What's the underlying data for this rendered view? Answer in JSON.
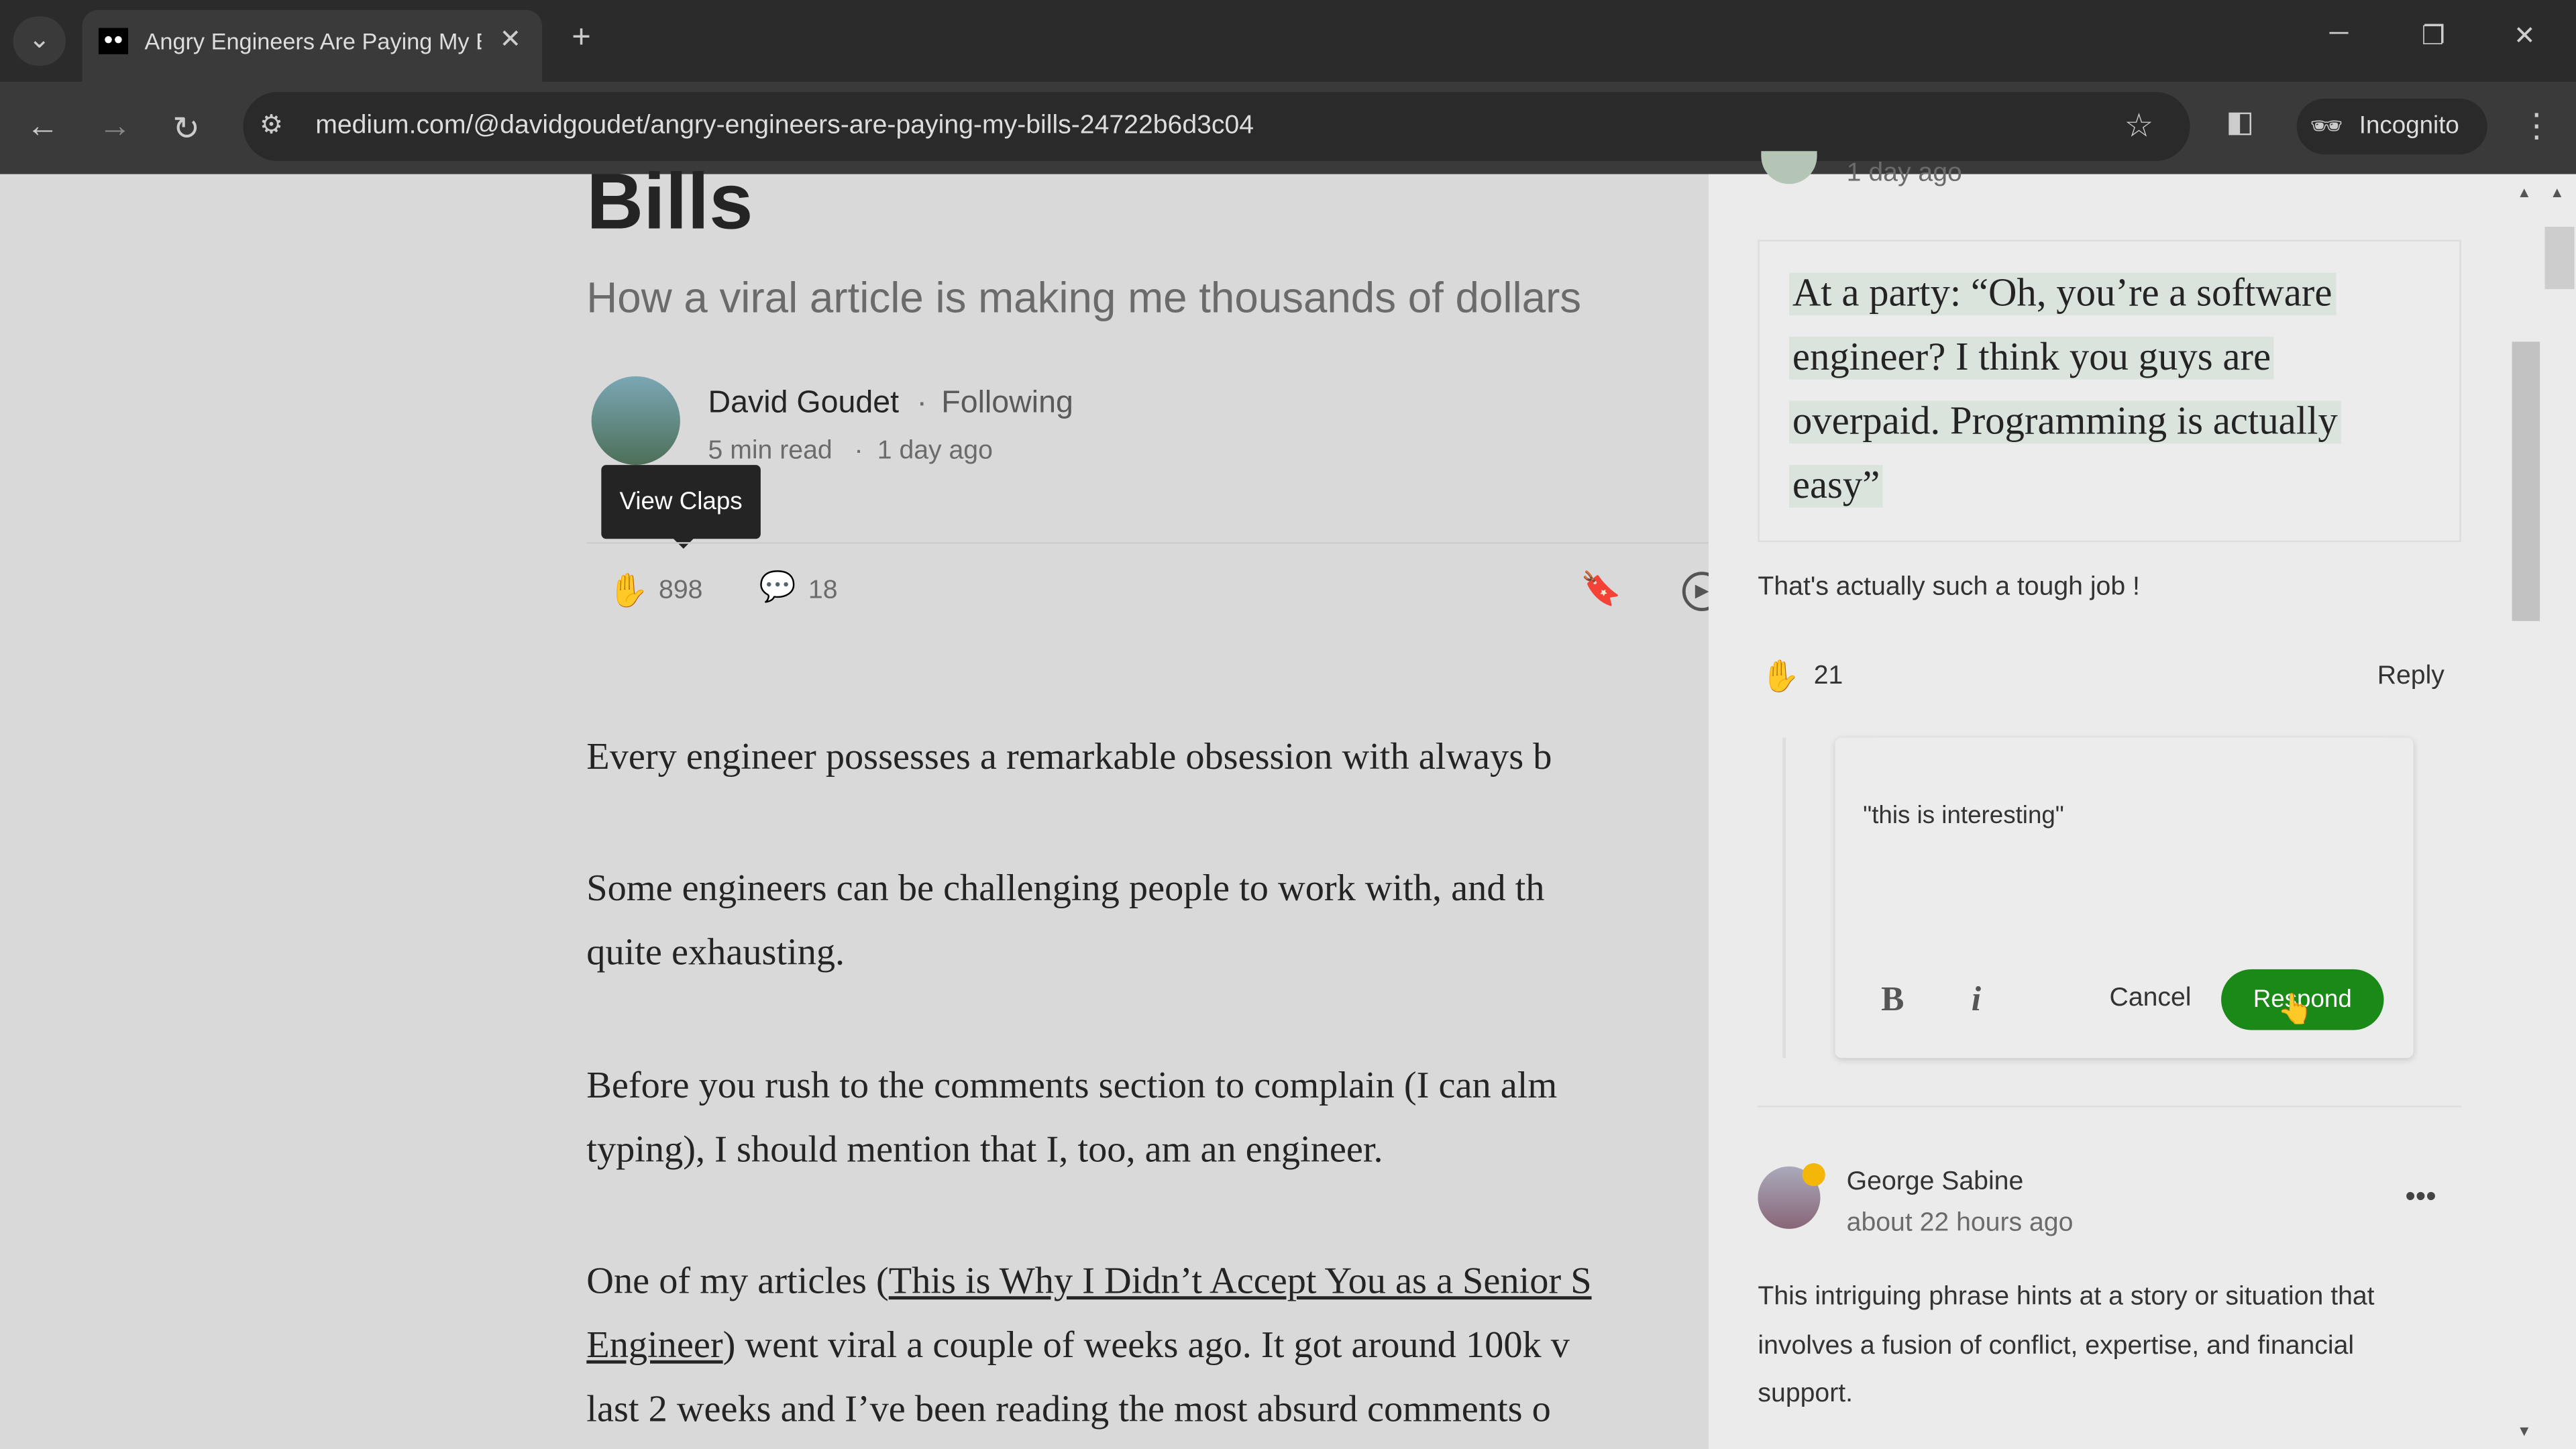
{
  "browser": {
    "tab_title": "Angry Engineers Are Paying My Bills",
    "url": "medium.com/@davidgoudet/angry-engineers-are-paying-my-bills-24722b6d3c04",
    "profile": "Incognito"
  },
  "article": {
    "title_fragment": "Bills",
    "subtitle": "How a viral article is making me thousands of dollars",
    "author": "David Goudet",
    "follow_status": "Following",
    "read_time": "5 min read",
    "published": "1 day ago",
    "tooltip": "View Claps",
    "claps": "898",
    "comments": "18",
    "paragraphs": [
      "Every engineer possesses a remarkable obsession with always b",
      "Some engineers can be challenging people to work with, and th",
      "quite exhausting.",
      "Before you rush to the comments section to complain (I can alm",
      "typing), I should mention that I, too, am an engineer."
    ],
    "para5": {
      "pre": "One of my articles (",
      "link1": "This is Why I Didn’t Accept You as a Senior S",
      "link2": "Engineer",
      "post2": ") went viral a couple of weeks ago. It got around 100k v",
      "line3": "last 2 weeks and I’ve been reading the most absurd comments o"
    }
  },
  "comments": {
    "prev_time": "1 day ago",
    "quote_lines": [
      "At a party: “Oh, you’re a software",
      "engineer? I think you guys are",
      "overpaid. Programming is actually",
      "easy”"
    ],
    "comment_text": "That's actually such a tough job !",
    "claps": "21",
    "reply_label": "Reply",
    "response_input": "\"this is interesting\"",
    "bold": "B",
    "italic": "i",
    "cancel": "Cancel",
    "respond": "Respond",
    "next": {
      "author": "George Sabine",
      "time": "about 22 hours ago",
      "text_lines": [
        "This intriguing phrase hints at a story or situation that",
        "involves a fusion of conflict, expertise, and financial",
        "support."
      ]
    }
  }
}
